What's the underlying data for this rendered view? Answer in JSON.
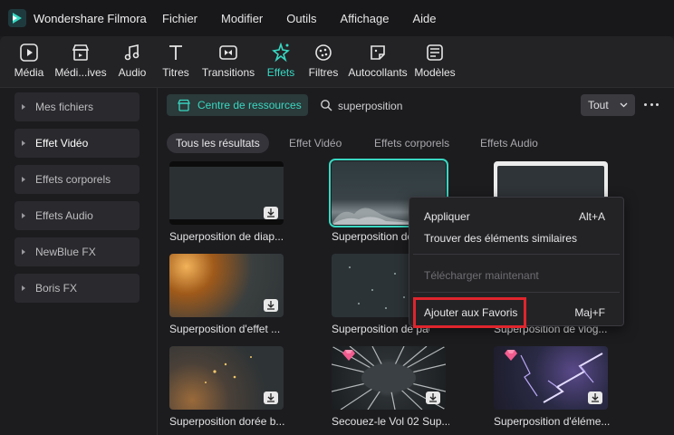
{
  "app": {
    "title": "Wondershare Filmora"
  },
  "menu": [
    "Fichier",
    "Modifier",
    "Outils",
    "Affichage",
    "Aide"
  ],
  "toolbar": [
    {
      "label": "Média",
      "icon": "media-icon"
    },
    {
      "label": "Médi...ives",
      "icon": "stock-media-icon"
    },
    {
      "label": "Audio",
      "icon": "music-note-icon"
    },
    {
      "label": "Titres",
      "icon": "title-t-icon"
    },
    {
      "label": "Transitions",
      "icon": "transition-icon"
    },
    {
      "label": "Effets",
      "icon": "sparkle-icon",
      "active": true
    },
    {
      "label": "Filtres",
      "icon": "filter-icon"
    },
    {
      "label": "Autocollants",
      "icon": "sticker-icon"
    },
    {
      "label": "Modèles",
      "icon": "template-icon"
    }
  ],
  "sidebar": [
    {
      "label": "Mes fichiers"
    },
    {
      "label": "Effet Vidéo",
      "active": true
    },
    {
      "label": "Effets corporels"
    },
    {
      "label": "Effets Audio"
    },
    {
      "label": "NewBlue FX"
    },
    {
      "label": "Boris FX"
    }
  ],
  "resource_button": "Centre de ressources",
  "search": {
    "value": "superposition"
  },
  "filter": {
    "selected": "Tout"
  },
  "tabs": [
    "Tous les résultats",
    "Effet Vidéo",
    "Effets corporels",
    "Effets Audio"
  ],
  "cards": [
    "Superposition de diap...",
    "Superposition de",
    "",
    "Superposition d'effet ...",
    "Superposition de pack...",
    "Superposition de vlog...",
    "Superposition dorée b...",
    "Secouez-le Vol 02 Sup...",
    "Superposition d'éléme..."
  ],
  "context_menu": {
    "apply": "Appliquer",
    "apply_shortcut": "Alt+A",
    "similar": "Trouver des éléments similaires",
    "download": "Télécharger maintenant",
    "favorite": "Ajouter aux Favoris",
    "favorite_shortcut": "Maj+F"
  },
  "colors": {
    "accent": "#37d9c3",
    "highlight": "#e0252d"
  }
}
